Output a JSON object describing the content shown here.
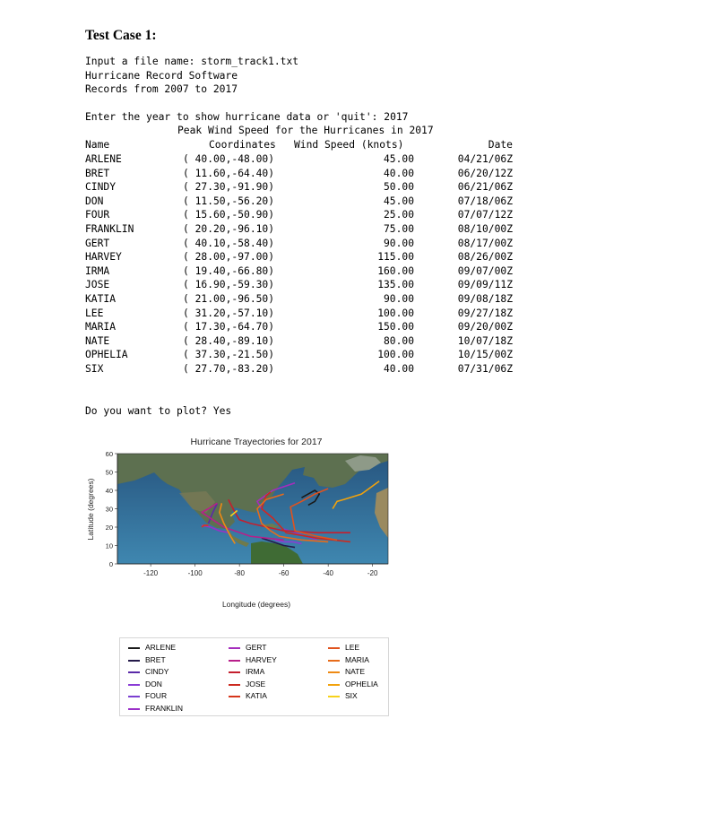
{
  "document": {
    "heading": "Test Case 1:",
    "intro_lines": [
      "Input a file name: storm_track1.txt",
      "Hurricane Record Software",
      "Records from 2007 to 2017"
    ],
    "prompt_year": "Enter the year to show hurricane data or 'quit': 2017",
    "table_title": "Peak Wind Speed for the Hurricanes in 2017",
    "columns": {
      "name": "Name",
      "coordinates": "Coordinates",
      "wind": "Wind Speed (knots)",
      "date": "Date"
    },
    "rows": [
      {
        "name": "ARLENE",
        "coords": "( 40.00,-48.00)",
        "wind": "45.00",
        "date": "04/21/06Z"
      },
      {
        "name": "BRET",
        "coords": "( 11.60,-64.40)",
        "wind": "40.00",
        "date": "06/20/12Z"
      },
      {
        "name": "CINDY",
        "coords": "( 27.30,-91.90)",
        "wind": "50.00",
        "date": "06/21/06Z"
      },
      {
        "name": "DON",
        "coords": "( 11.50,-56.20)",
        "wind": "45.00",
        "date": "07/18/06Z"
      },
      {
        "name": "FOUR",
        "coords": "( 15.60,-50.90)",
        "wind": "25.00",
        "date": "07/07/12Z"
      },
      {
        "name": "FRANKLIN",
        "coords": "( 20.20,-96.10)",
        "wind": "75.00",
        "date": "08/10/00Z"
      },
      {
        "name": "GERT",
        "coords": "( 40.10,-58.40)",
        "wind": "90.00",
        "date": "08/17/00Z"
      },
      {
        "name": "HARVEY",
        "coords": "( 28.00,-97.00)",
        "wind": "115.00",
        "date": "08/26/00Z"
      },
      {
        "name": "IRMA",
        "coords": "( 19.40,-66.80)",
        "wind": "160.00",
        "date": "09/07/00Z"
      },
      {
        "name": "JOSE",
        "coords": "( 16.90,-59.30)",
        "wind": "135.00",
        "date": "09/09/11Z"
      },
      {
        "name": "KATIA",
        "coords": "( 21.00,-96.50)",
        "wind": "90.00",
        "date": "09/08/18Z"
      },
      {
        "name": "LEE",
        "coords": "( 31.20,-57.10)",
        "wind": "100.00",
        "date": "09/27/18Z"
      },
      {
        "name": "MARIA",
        "coords": "( 17.30,-64.70)",
        "wind": "150.00",
        "date": "09/20/00Z"
      },
      {
        "name": "NATE",
        "coords": "( 28.40,-89.10)",
        "wind": "80.00",
        "date": "10/07/18Z"
      },
      {
        "name": "OPHELIA",
        "coords": "( 37.30,-21.50)",
        "wind": "100.00",
        "date": "10/15/00Z"
      },
      {
        "name": "SIX",
        "coords": "( 27.70,-83.20)",
        "wind": "40.00",
        "date": "07/31/06Z"
      }
    ],
    "prompt_plot": "Do you want to plot? Yes"
  },
  "chart_data": {
    "type": "line",
    "title": "Hurricane Trayectories for 2017",
    "xlabel": "Longitude (degrees)",
    "ylabel": "Latitude (degrees)",
    "xlim": [
      -135,
      -13
    ],
    "ylim": [
      0,
      60
    ],
    "xticks": [
      -120,
      -100,
      -80,
      -60,
      -40,
      -20
    ],
    "yticks": [
      0,
      10,
      20,
      30,
      40,
      50,
      60
    ],
    "legend_position": "below",
    "series": [
      {
        "name": "ARLENE",
        "color": "#1a1a1a",
        "x": [
          -52,
          -49,
          -46,
          -44,
          -46,
          -49
        ],
        "y": [
          36,
          38,
          40,
          38,
          34,
          32
        ]
      },
      {
        "name": "BRET",
        "color": "#241a4a",
        "x": [
          -55,
          -60,
          -65,
          -70
        ],
        "y": [
          9,
          10,
          12,
          14
        ]
      },
      {
        "name": "CINDY",
        "color": "#5a2aa8",
        "x": [
          -94,
          -93,
          -92,
          -90
        ],
        "y": [
          22,
          25,
          28,
          33
        ]
      },
      {
        "name": "DON",
        "color": "#8a3cd6",
        "x": [
          -52,
          -56,
          -60,
          -64
        ],
        "y": [
          11,
          12,
          12,
          13
        ]
      },
      {
        "name": "FOUR",
        "color": "#7b3fd1",
        "x": [
          -45,
          -50,
          -55,
          -60
        ],
        "y": [
          13,
          15,
          17,
          19
        ]
      },
      {
        "name": "FRANKLIN",
        "color": "#9b30c8",
        "x": [
          -85,
          -89,
          -93,
          -97
        ],
        "y": [
          17,
          18,
          20,
          21
        ]
      },
      {
        "name": "GERT",
        "color": "#a52dbd",
        "x": [
          -65,
          -70,
          -72,
          -65,
          -55
        ],
        "y": [
          25,
          30,
          34,
          40,
          44
        ]
      },
      {
        "name": "HARVEY",
        "color": "#b81f8a",
        "x": [
          -60,
          -75,
          -87,
          -97,
          -94,
          -90
        ],
        "y": [
          13,
          15,
          20,
          28,
          30,
          33
        ]
      },
      {
        "name": "IRMA",
        "color": "#c41f2e",
        "x": [
          -30,
          -45,
          -60,
          -75,
          -80,
          -82,
          -85
        ],
        "y": [
          17,
          17,
          18,
          22,
          24,
          28,
          35
        ]
      },
      {
        "name": "JOSE",
        "color": "#cc2a1f",
        "x": [
          -30,
          -45,
          -59,
          -65,
          -70,
          -68,
          -66
        ],
        "y": [
          12,
          14,
          17,
          25,
          30,
          37,
          39
        ]
      },
      {
        "name": "KATIA",
        "color": "#d6361b",
        "x": [
          -94,
          -96,
          -97
        ],
        "y": [
          21,
          21,
          20
        ]
      },
      {
        "name": "LEE",
        "color": "#e0531e",
        "x": [
          -36,
          -45,
          -55,
          -57,
          -52,
          -46,
          -40
        ],
        "y": [
          13,
          15,
          18,
          31,
          34,
          38,
          41
        ]
      },
      {
        "name": "MARIA",
        "color": "#e76c1a",
        "x": [
          -40,
          -52,
          -62,
          -66,
          -70,
          -72,
          -68,
          -60
        ],
        "y": [
          12,
          13,
          15,
          18,
          22,
          30,
          35,
          38
        ]
      },
      {
        "name": "NATE",
        "color": "#ee8a14",
        "x": [
          -82,
          -84,
          -87,
          -89,
          -88
        ],
        "y": [
          11,
          15,
          22,
          28,
          33
        ]
      },
      {
        "name": "OPHELIA",
        "color": "#f2a20c",
        "x": [
          -38,
          -37,
          -36,
          -33,
          -25,
          -17
        ],
        "y": [
          30,
          32,
          34,
          35,
          38,
          45
        ]
      },
      {
        "name": "SIX",
        "color": "#f7d21b",
        "x": [
          -84,
          -83,
          -81
        ],
        "y": [
          26,
          27,
          29
        ]
      }
    ]
  }
}
